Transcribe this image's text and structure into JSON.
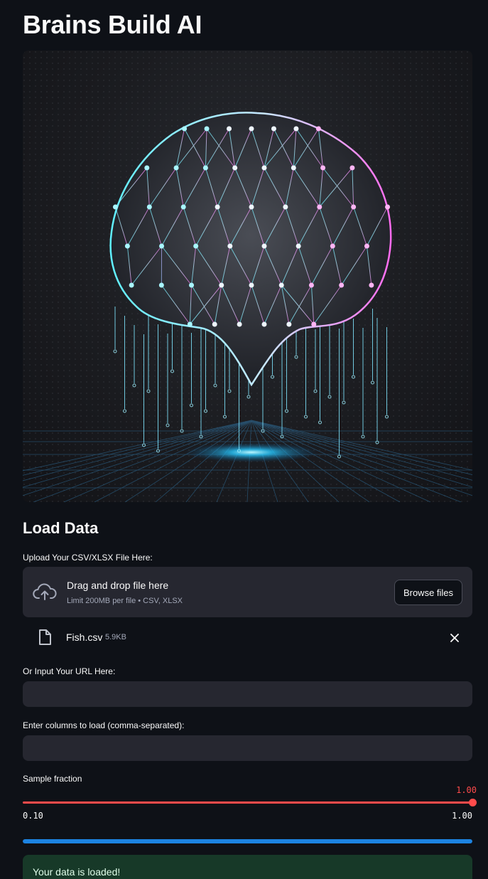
{
  "app": {
    "title": "Brains Build AI"
  },
  "hero": {
    "icon": "brain-network-illustration"
  },
  "load_data": {
    "heading": "Load Data",
    "upload": {
      "label": "Upload Your CSV/XLSX File Here:",
      "dropzone_title": "Drag and drop file here",
      "dropzone_limit": "Limit 200MB per file • CSV, XLSX",
      "browse_label": "Browse files",
      "icon": "cloud-upload-icon"
    },
    "uploaded_file": {
      "name": "Fish.csv",
      "size": "5.9KB",
      "icon": "file-icon",
      "remove_icon": "close-icon"
    },
    "url_input": {
      "label": "Or Input Your URL Here:",
      "value": "",
      "placeholder": ""
    },
    "columns_input": {
      "label": "Enter columns to load (comma-separated):",
      "value": "",
      "placeholder": ""
    },
    "sample_slider": {
      "label": "Sample fraction",
      "value": "1.00",
      "min": "0.10",
      "max": "1.00",
      "fraction": 1.0
    },
    "progress": {
      "fraction": 1.0
    },
    "status": {
      "message": "Your data is loaded!"
    }
  },
  "colors": {
    "background": "#0e1117",
    "surface": "#262730",
    "accent_red": "#ff4b4b",
    "progress_blue": "#1c83e1",
    "success_bg": "#173928",
    "success_text": "#dffde9"
  }
}
